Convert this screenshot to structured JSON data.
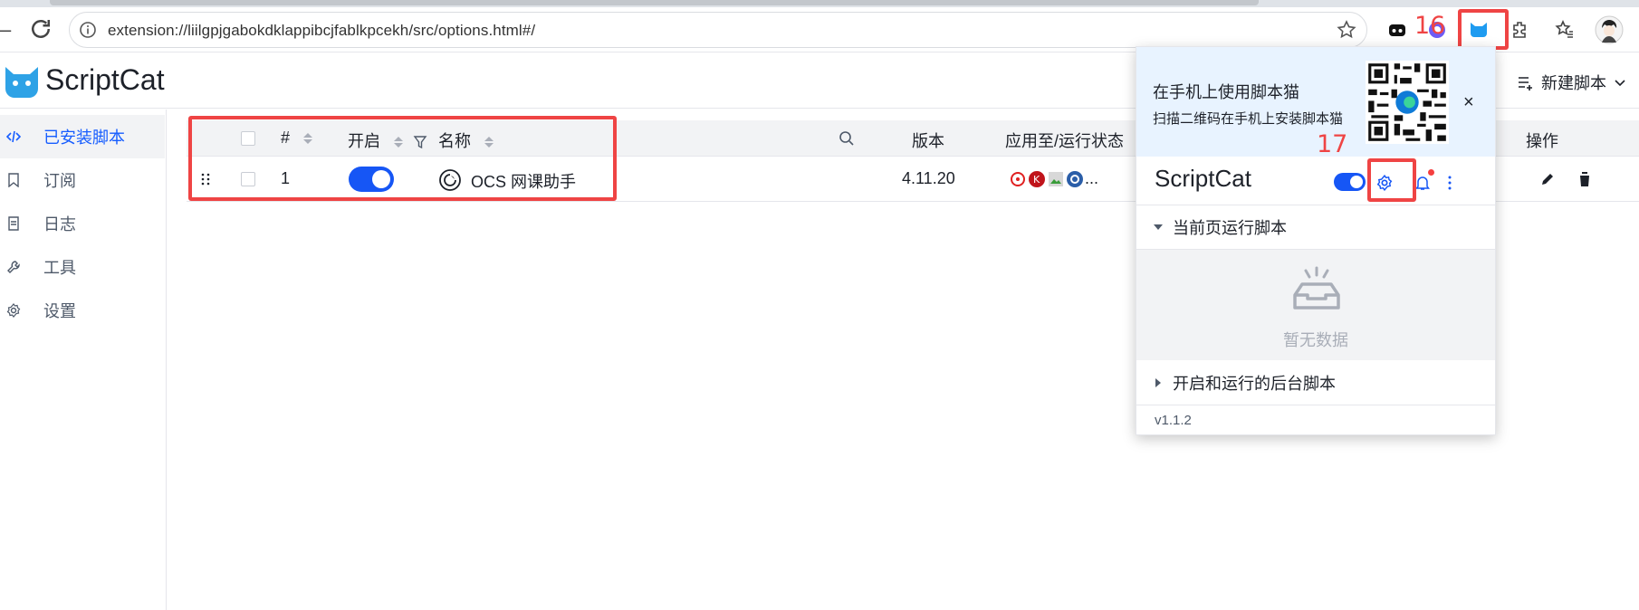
{
  "browser": {
    "url": "extension://liilgpjgabokdklappibcjfablkpcekh/src/options.html#/"
  },
  "annotations": {
    "step16": "16",
    "step17": "17"
  },
  "app": {
    "brand": "ScriptCat",
    "new_script_label": "新建脚本"
  },
  "sidebar": {
    "items": [
      {
        "label": "已安装脚本",
        "icon": "code-icon",
        "active": true
      },
      {
        "label": "订阅",
        "icon": "bookmark-icon",
        "active": false
      },
      {
        "label": "日志",
        "icon": "file-icon",
        "active": false
      },
      {
        "label": "工具",
        "icon": "wrench-icon",
        "active": false
      },
      {
        "label": "设置",
        "icon": "gear-icon",
        "active": false
      }
    ]
  },
  "table": {
    "columns": {
      "index": "#",
      "enabled": "开启",
      "name": "名称",
      "version": "版本",
      "apply": "应用至/运行状态",
      "actions": "操作"
    },
    "rows": [
      {
        "index": "1",
        "enabled": true,
        "name": "OCS 网课助手",
        "version": "4.11.20",
        "apply_more": "..."
      }
    ]
  },
  "popup": {
    "banner_title": "在手机上使用脚本猫",
    "banner_sub": "扫描二维码在手机上安装脚本猫",
    "close_glyph": "×",
    "title": "ScriptCat",
    "current_page_section": "当前页运行脚本",
    "empty_text": "暂无数据",
    "background_section": "开启和运行的后台脚本",
    "version": "v1.1.2"
  },
  "colors": {
    "accent": "#1656f5",
    "highlight_box": "#ef4444",
    "banner_bg": "#e8f3ff"
  }
}
